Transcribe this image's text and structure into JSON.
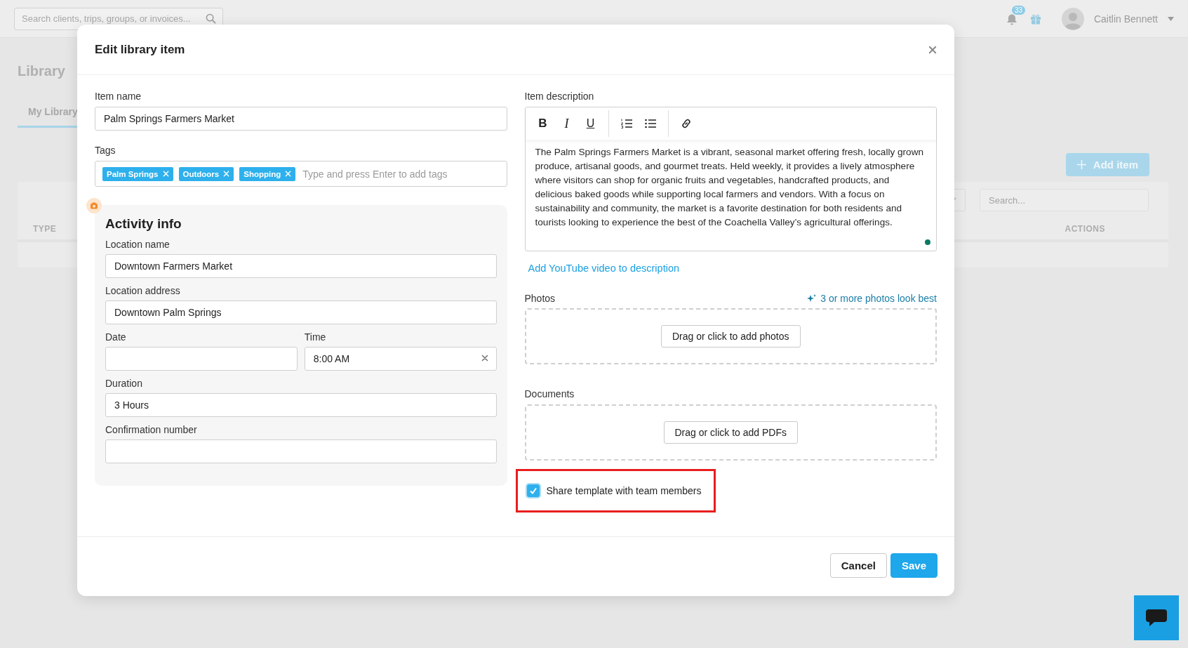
{
  "top_bar": {
    "search_placeholder": "Search clients, trips, groups, or invoices...",
    "notification_count": "33",
    "user_name": "Caitlin Bennett"
  },
  "page": {
    "title": "Library",
    "tabs": [
      {
        "label": "My Library",
        "selected": true
      }
    ],
    "add_button": "Add item",
    "filter_search_placeholder": "Search...",
    "table_columns": [
      "TYPE",
      "ACTIONS"
    ]
  },
  "dialog": {
    "title": "Edit library item",
    "item_name": {
      "label": "Item name",
      "value": "Palm Springs Farmers Market"
    },
    "tags": {
      "label": "Tags",
      "items": [
        "Palm Springs",
        "Outdoors",
        "Shopping"
      ],
      "placeholder": "Type and press Enter to add tags"
    },
    "activity": {
      "title": "Activity info",
      "rows": [
        [
          {
            "label": "Location name",
            "value": "Downtown Farmers Market",
            "clearable": false
          }
        ],
        [
          {
            "label": "Location address",
            "value": "Downtown Palm Springs",
            "clearable": false
          }
        ],
        [
          {
            "label": "Date",
            "clearable": false
          },
          {
            "label": "Time",
            "value": "8:00 AM",
            "clearable": true
          }
        ],
        [
          {
            "label": "Duration",
            "value": "3 Hours",
            "clearable": false
          }
        ],
        [
          {
            "label": "Confirmation number",
            "clearable": false
          }
        ]
      ]
    },
    "description": {
      "label": "Item description",
      "toolbar": [
        {
          "kind": "bold",
          "label": "B"
        },
        {
          "kind": "italic",
          "label": "I"
        },
        {
          "kind": "underline",
          "label": "U"
        },
        {
          "kind": "ordered-list"
        },
        {
          "kind": "bullet-list"
        },
        {
          "kind": "link"
        }
      ],
      "text": "The Palm Springs Farmers Market is a vibrant, seasonal market offering fresh, locally grown produce, artisanal goods, and gourmet treats. Held weekly, it provides a lively atmosphere where visitors can shop for organic fruits and vegetables, handcrafted products, and delicious baked goods while supporting local farmers and vendors. With a focus on sustainability and community, the market is a favorite destination for both residents and tourists looking to experience the best of the Coachella Valley’s agricultural offerings."
    },
    "youtube_link": "Add YouTube video to description",
    "photos": {
      "label": "Photos",
      "hint": "3 or more photos look best",
      "button": "Drag or click to add photos"
    },
    "documents": {
      "label": "Documents",
      "button": "Drag or click to add PDFs"
    },
    "share": {
      "label": "Share template with team members",
      "checked": true
    },
    "buttons": [
      {
        "label": "Cancel",
        "kind": "secondary"
      },
      {
        "label": "Save",
        "kind": "primary"
      }
    ]
  }
}
